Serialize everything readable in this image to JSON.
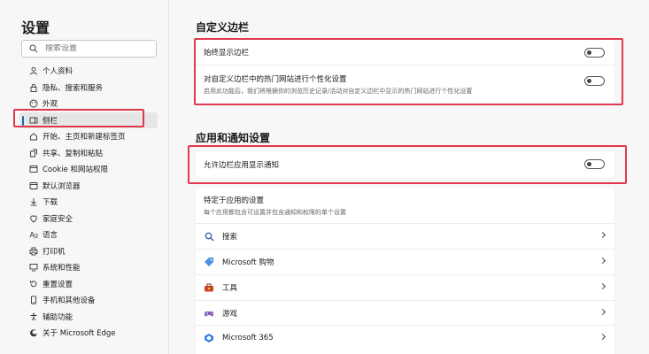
{
  "sidebar": {
    "title": "设置",
    "search_placeholder": "搜索设置",
    "items": [
      {
        "label": "个人资料",
        "icon": "profile-icon"
      },
      {
        "label": "隐私、搜索和服务",
        "icon": "lock-icon"
      },
      {
        "label": "外观",
        "icon": "appearance-icon"
      },
      {
        "label": "侧栏",
        "icon": "sidebar-icon",
        "active": true
      },
      {
        "label": "开始、主页和新建标签页",
        "icon": "home-icon"
      },
      {
        "label": "共享、复制和粘贴",
        "icon": "share-icon"
      },
      {
        "label": "Cookie 和网站权限",
        "icon": "cookie-icon"
      },
      {
        "label": "默认浏览器",
        "icon": "browser-icon"
      },
      {
        "label": "下载",
        "icon": "download-icon"
      },
      {
        "label": "家庭安全",
        "icon": "family-icon"
      },
      {
        "label": "语言",
        "icon": "language-icon"
      },
      {
        "label": "打印机",
        "icon": "printer-icon"
      },
      {
        "label": "系统和性能",
        "icon": "system-icon"
      },
      {
        "label": "重置设置",
        "icon": "reset-icon"
      },
      {
        "label": "手机和其他设备",
        "icon": "phone-icon"
      },
      {
        "label": "辅助功能",
        "icon": "accessibility-icon"
      },
      {
        "label": "关于 Microsoft Edge",
        "icon": "edge-icon"
      }
    ]
  },
  "custom_sidebar": {
    "title": "自定义边栏",
    "always_show_label": "始终显示边栏",
    "hot_sites_label": "对自定义边栏中的热门网站进行个性化设置",
    "hot_sites_desc": "启用此功能后，我们将根据你的浏览历史记录/活动对自定义边栏中显示的热门网站进行个性化设置"
  },
  "app_notifications": {
    "title": "应用和通知设置",
    "allow_notify_label": "允许边栏应用显示通知",
    "app_specific_title": "特定于应用的设置",
    "app_specific_desc": "每个应用都包含可设置并包含通知和权限的单个设置",
    "apps": [
      {
        "label": "搜索",
        "icon": "search-icon"
      },
      {
        "label": "Microsoft 购物",
        "icon": "shopping-tag-icon"
      },
      {
        "label": "工具",
        "icon": "toolbox-icon"
      },
      {
        "label": "游戏",
        "icon": "games-icon"
      },
      {
        "label": "Microsoft 365",
        "icon": "microsoft365-icon"
      }
    ]
  },
  "colors": {
    "highlight": "#e0394f",
    "accent": "#0f6cbd"
  }
}
